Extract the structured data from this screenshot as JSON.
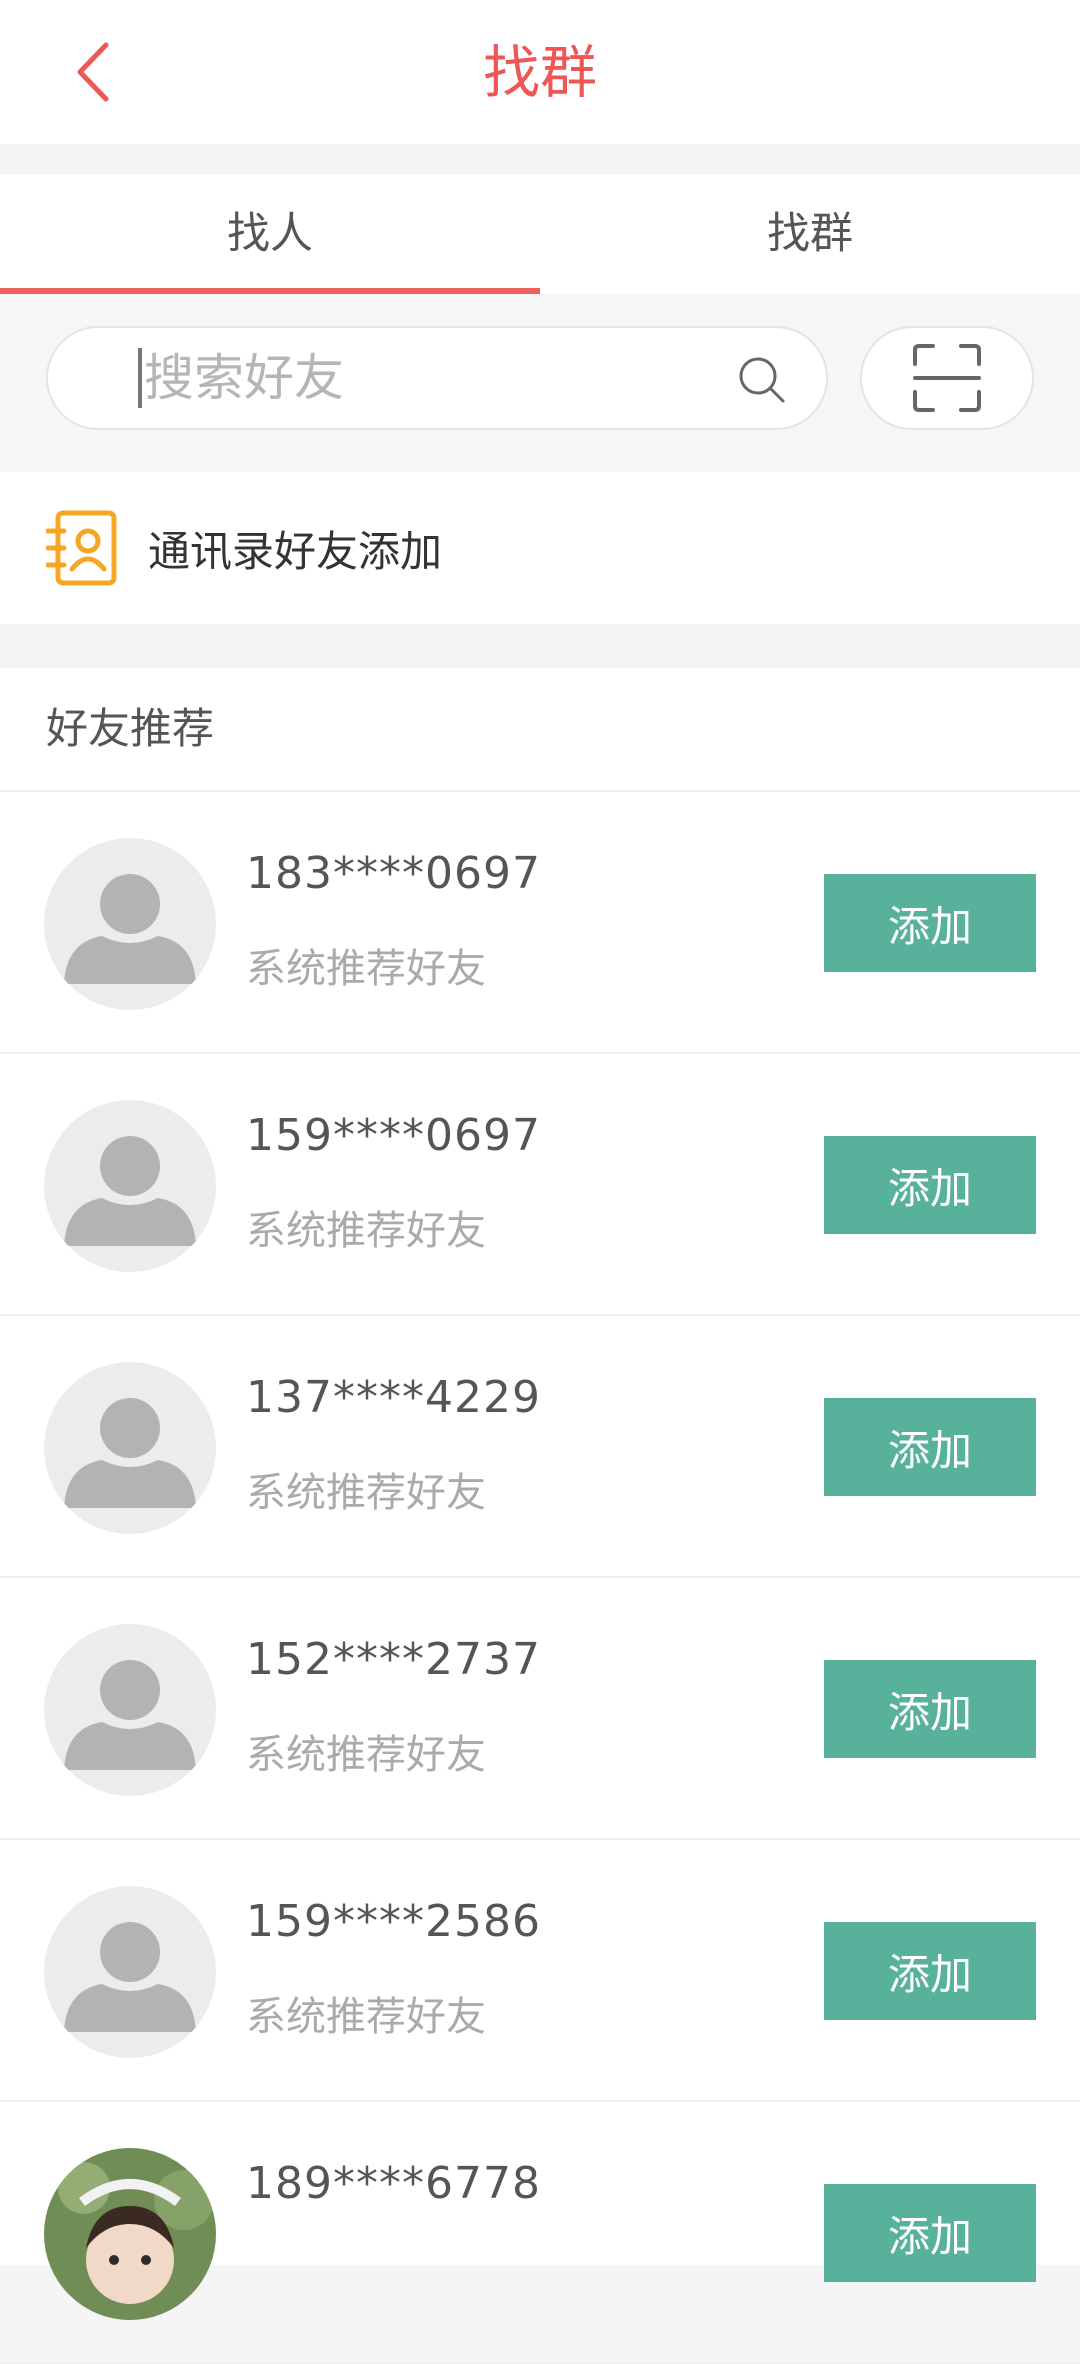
{
  "header": {
    "title": "找群"
  },
  "tabs": [
    {
      "label": "找人",
      "active": true
    },
    {
      "label": "找群",
      "active": false
    }
  ],
  "search": {
    "placeholder": "搜索好友",
    "value": ""
  },
  "contacts_entry": {
    "label": "通讯录好友添加"
  },
  "recommend": {
    "title": "好友推荐",
    "add_label": "添加",
    "items": [
      {
        "phone": "183****0697",
        "desc": "系统推荐好友",
        "avatar": "default"
      },
      {
        "phone": "159****0697",
        "desc": "系统推荐好友",
        "avatar": "default"
      },
      {
        "phone": "137****4229",
        "desc": "系统推荐好友",
        "avatar": "default"
      },
      {
        "phone": "152****2737",
        "desc": "系统推荐好友",
        "avatar": "default"
      },
      {
        "phone": "159****2586",
        "desc": "系统推荐好友",
        "avatar": "default"
      },
      {
        "phone": "189****6778",
        "desc": "",
        "avatar": "photo"
      }
    ]
  },
  "colors": {
    "accent": "#ef5656",
    "add_button": "#58b19a",
    "contacts_icon": "#f5a623"
  },
  "icons": {
    "back": "chevron-left-icon",
    "search": "search-icon",
    "scan": "scan-icon",
    "contacts": "contacts-book-icon"
  }
}
